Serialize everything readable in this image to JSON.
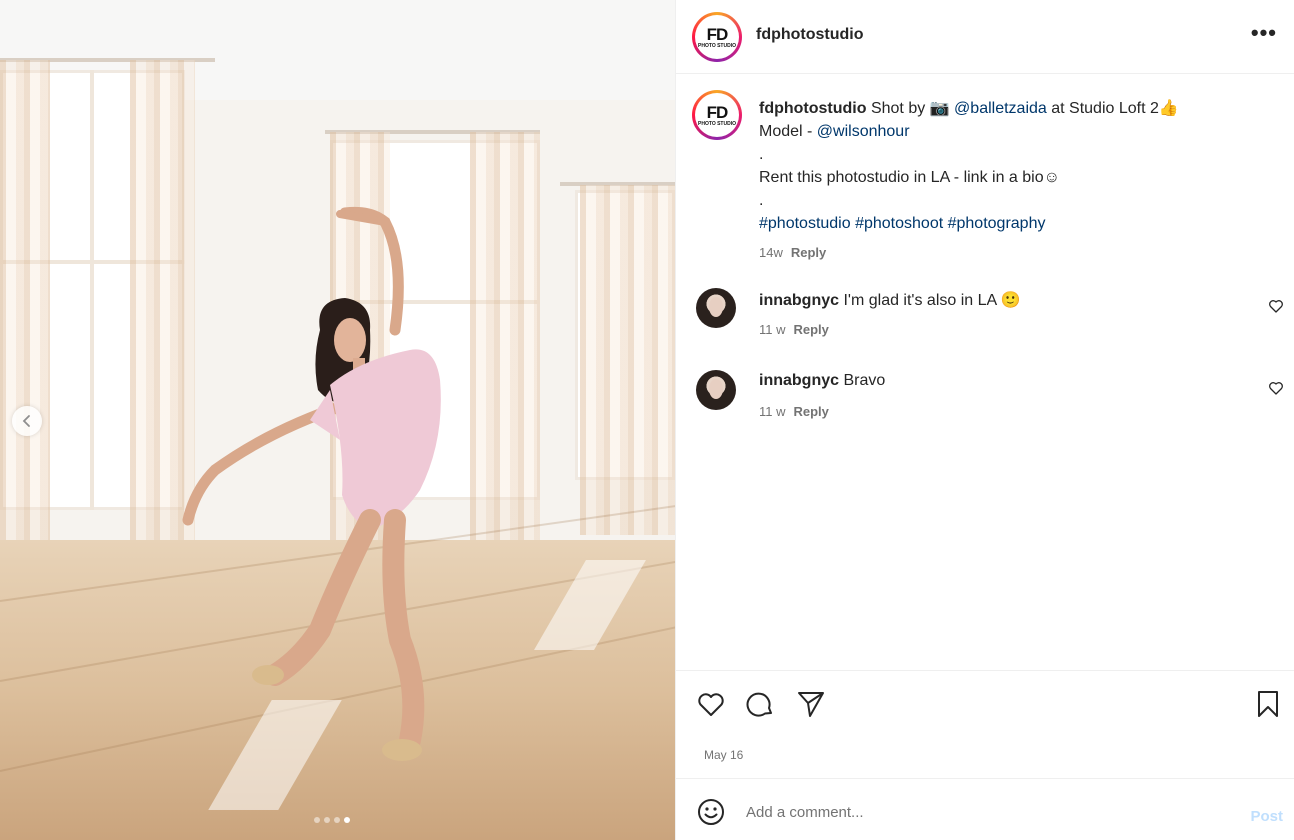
{
  "post": {
    "author": "fdphotostudio",
    "avatar_text": "FD",
    "avatar_subtext": "PHOTO STUDIO",
    "more_icon": "more-horizontal-icon",
    "carousel": {
      "total": 4,
      "active": 4
    }
  },
  "caption": {
    "username": "fdphotostudio",
    "line1_text": " Shot by ",
    "camera_emoji": "📷",
    "mention1": "@balletzaida",
    "line1_tail": " at Studio Loft 2",
    "thumbs_emoji": "👍",
    "line2_prefix": "Model - ",
    "mention2": "@wilsonhour",
    "dot1": ".",
    "line3": "Rent this photostudio in LA - link in a bio☺",
    "dot2": ".",
    "hashtags": "#photostudio #photoshoot #photography",
    "time": "14w",
    "reply": "Reply"
  },
  "comments": [
    {
      "username": "innabgnyc",
      "text": " I'm glad it's also in LA 🙂",
      "time": "11 w",
      "reply": "Reply"
    },
    {
      "username": "innabgnyc",
      "text": " Bravo",
      "time": "11 w",
      "reply": "Reply"
    }
  ],
  "actions": {
    "icons": [
      "heart-icon",
      "comment-icon",
      "share-icon",
      "bookmark-icon"
    ],
    "date": "May 16"
  },
  "add_comment": {
    "placeholder": "Add a comment...",
    "post_label": "Post"
  },
  "colors": {
    "link": "#00376b",
    "muted": "#737373",
    "post_disabled": "#c0dffd"
  }
}
